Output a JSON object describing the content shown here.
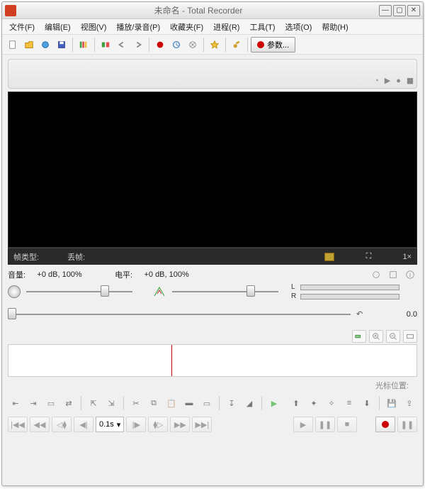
{
  "title": "未命名 - Total Recorder",
  "menu": {
    "file": "文件(F)",
    "edit": "编辑(E)",
    "view": "视图(V)",
    "play": "播放/录音(P)",
    "fav": "收藏夹(F)",
    "process": "进程(R)",
    "tools": "工具(T)",
    "options": "选项(O)",
    "help": "帮助(H)"
  },
  "toolbar": {
    "params": "参数..."
  },
  "video_bar": {
    "frame_type": "帧类型:",
    "drop_frame": "丢帧:",
    "zoom": "1×"
  },
  "audio": {
    "vol_label": "音量:",
    "vol_value": "+0 dB, 100%",
    "lvl_label": "电平:",
    "lvl_value": "+0 dB, 100%",
    "ch_l": "L",
    "ch_r": "R"
  },
  "scrub": {
    "time": "0.0"
  },
  "cursor_pos_label": "光标位置:",
  "step": "0.1s",
  "icons": {
    "new": "new-file-icon",
    "open": "open-folder-icon",
    "save": "save-icon",
    "saveas": "saveas-icon"
  }
}
